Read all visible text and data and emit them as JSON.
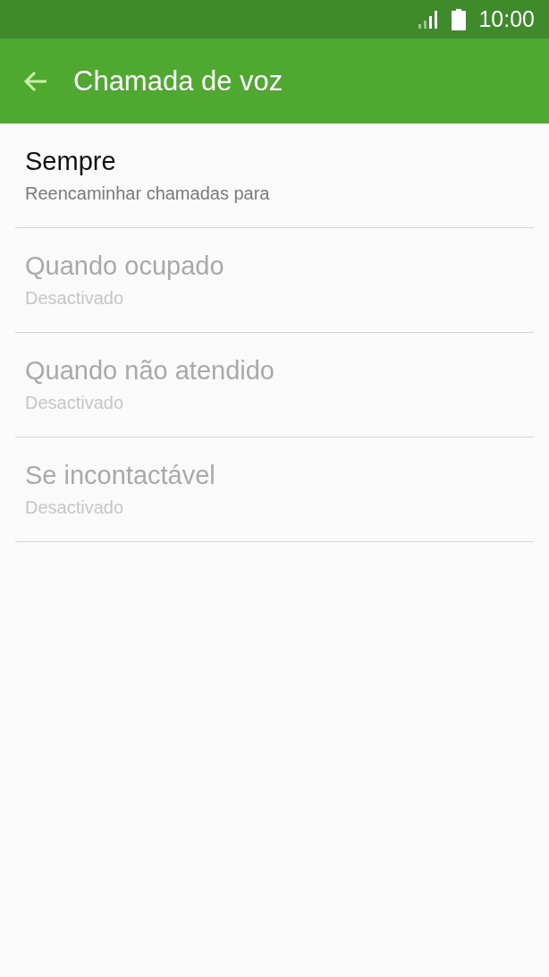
{
  "status_bar": {
    "time": "10:00"
  },
  "app_bar": {
    "title": "Chamada de voz"
  },
  "items": [
    {
      "title": "Sempre",
      "subtitle": "Reencaminhar chamadas para",
      "disabled": false
    },
    {
      "title": "Quando ocupado",
      "subtitle": "Desactivado",
      "disabled": true
    },
    {
      "title": "Quando não atendido",
      "subtitle": "Desactivado",
      "disabled": true
    },
    {
      "title": "Se incontactável",
      "subtitle": "Desactivado",
      "disabled": true
    }
  ]
}
